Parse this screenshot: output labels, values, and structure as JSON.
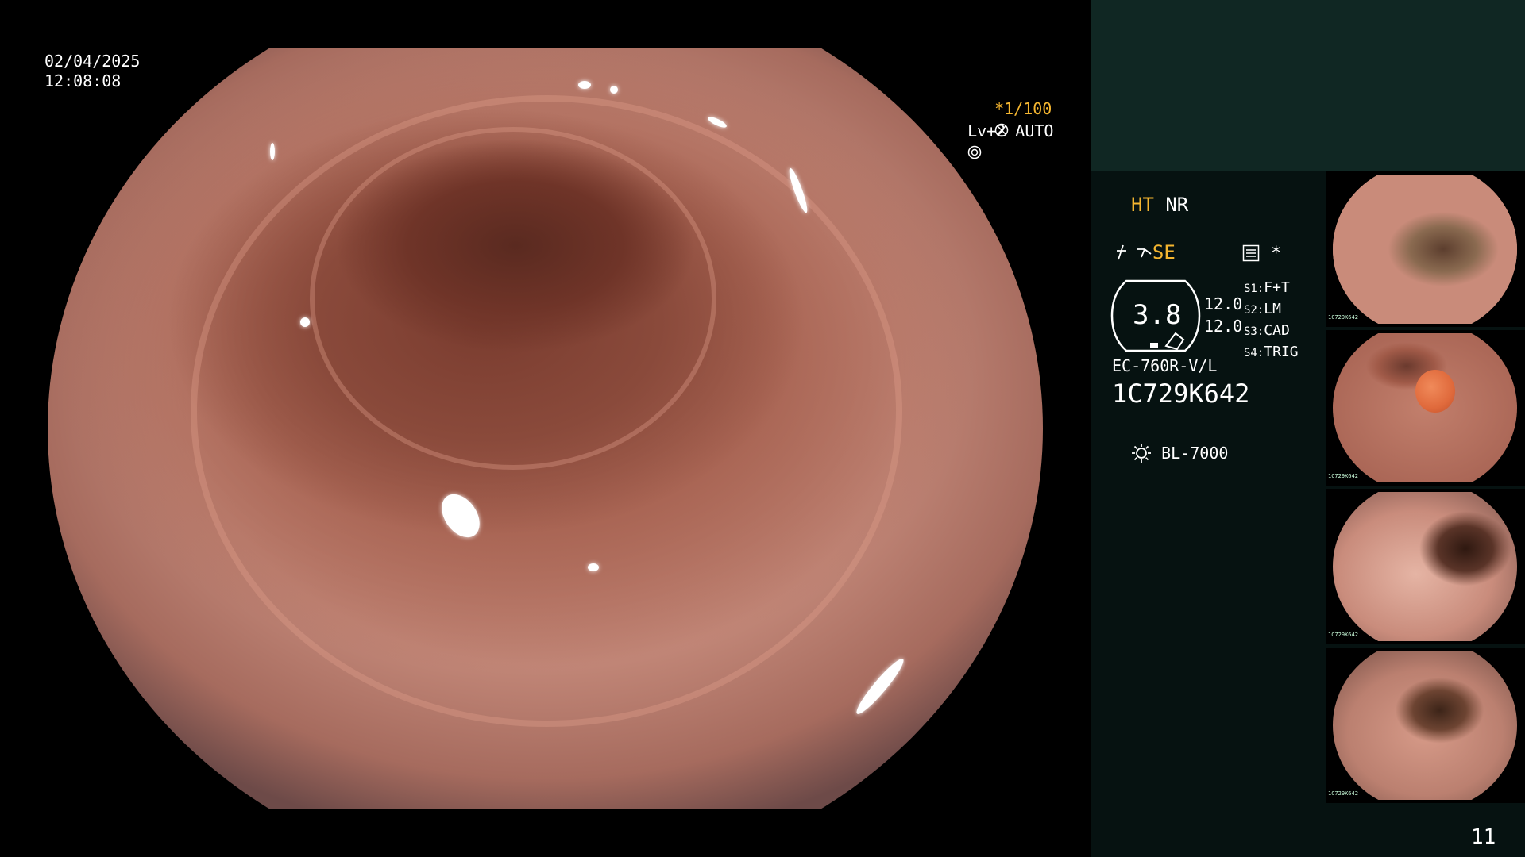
{
  "header": {
    "date": "02/04/2025",
    "time": "12:08:08",
    "shutter": "*1/100",
    "level": "Lv+2 AUTO"
  },
  "settings": {
    "ht": "HT",
    "nr": "NR",
    "se": "SE",
    "value": "3.8",
    "num1": "12.0",
    "num2": "12.0",
    "s1_key": "S1:",
    "s1_val": "F+T",
    "s2_key": "S2:",
    "s2_val": "LM",
    "s3_key": "S3:",
    "s3_val": "CAD",
    "s4_key": "S4:",
    "s4_val": "TRIG",
    "asterisk": "*",
    "scope_model": "EC-760R-V/L",
    "serial": "1C729K642",
    "light_source": "BL-7000"
  },
  "thumbnails": [
    {
      "serial": "1C729K642"
    },
    {
      "serial": "1C729K642"
    },
    {
      "serial": "1C729K642"
    },
    {
      "serial": "1C729K642"
    }
  ],
  "image_count": "11",
  "colors": {
    "accent_yellow": "#f5b630",
    "panel_top": "#102723",
    "panel_bottom": "#061211"
  },
  "icons": [
    "shutter-icon",
    "auto-iris-icon",
    "structure-icon",
    "color-icon",
    "menu-icon",
    "lamp-icon"
  ]
}
